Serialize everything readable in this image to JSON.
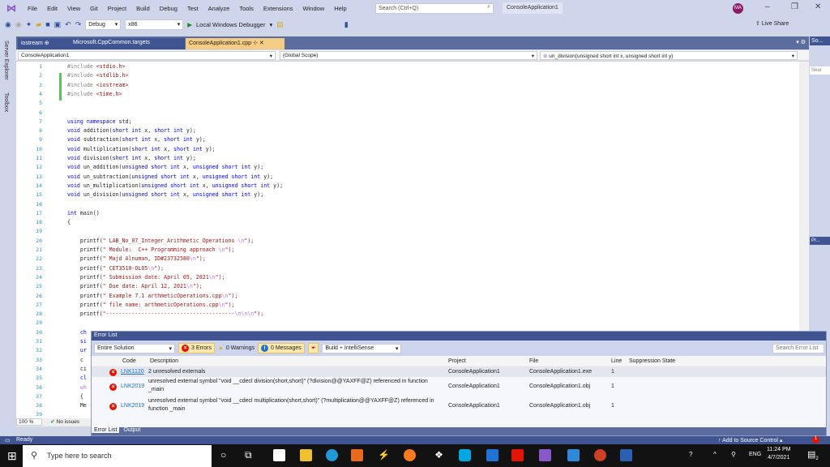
{
  "menubar": {
    "items": [
      "File",
      "Edit",
      "View",
      "Git",
      "Project",
      "Build",
      "Debug",
      "Test",
      "Analyze",
      "Tools",
      "Extensions",
      "Window",
      "Help"
    ],
    "search_placeholder": "Search (Ctrl+Q)",
    "app_title": "ConsoleApplication1",
    "avatar": "MA"
  },
  "toolbar": {
    "config": "Debug",
    "platform": "x86",
    "run_label": "Local Windows Debugger",
    "live_share": "Live Share"
  },
  "sidebar": {
    "server_explorer": "Server Explorer",
    "toolbox": "Toolbox"
  },
  "tabs": [
    {
      "label": "iostream",
      "pin": "⊕"
    },
    {
      "label": "Microsoft.CppCommon.targets"
    },
    {
      "label": "ConsoleApplication1.cpp",
      "active": true
    }
  ],
  "right_panel": {
    "label": "So...",
    "search": "Sear",
    "pr": "Pr..."
  },
  "navbar": {
    "project": "ConsoleApplication1",
    "scope": "(Global Scope)",
    "member": "un_division(unsigned short int x, unsigned short int y)"
  },
  "code_lines": [
    [
      [
        "#include ",
        "pp"
      ],
      [
        "<stdio.h>",
        "str"
      ]
    ],
    [
      [
        "#include ",
        "pp"
      ],
      [
        "<stdlib.h>",
        "str"
      ]
    ],
    [
      [
        "#include ",
        "pp"
      ],
      [
        "<iostream>",
        "str"
      ]
    ],
    [
      [
        "#include ",
        "pp"
      ],
      [
        "<time.h>",
        "str"
      ]
    ],
    [],
    [],
    [
      [
        "using namespace ",
        "kw"
      ],
      [
        "std;",
        "plain"
      ]
    ],
    [
      [
        "void ",
        "kw"
      ],
      [
        "addition(",
        "fn"
      ],
      [
        "short int ",
        "kw"
      ],
      [
        "x, ",
        "plain"
      ],
      [
        "short int ",
        "kw"
      ],
      [
        "y);",
        "plain"
      ]
    ],
    [
      [
        "void ",
        "kw"
      ],
      [
        "subtraction(",
        "fn"
      ],
      [
        "short int ",
        "kw"
      ],
      [
        "x, ",
        "plain"
      ],
      [
        "short int ",
        "kw"
      ],
      [
        "y);",
        "plain"
      ]
    ],
    [
      [
        "void ",
        "kw"
      ],
      [
        "multiplication(",
        "fn"
      ],
      [
        "short int ",
        "kw"
      ],
      [
        "x, ",
        "plain"
      ],
      [
        "short int ",
        "kw"
      ],
      [
        "y);",
        "plain"
      ]
    ],
    [
      [
        "void ",
        "kw"
      ],
      [
        "division(",
        "fn"
      ],
      [
        "short int ",
        "kw"
      ],
      [
        "x, ",
        "plain"
      ],
      [
        "short int ",
        "kw"
      ],
      [
        "y);",
        "plain"
      ]
    ],
    [
      [
        "void ",
        "kw"
      ],
      [
        "un_addition(",
        "fn"
      ],
      [
        "unsigned short int ",
        "kw"
      ],
      [
        "x, ",
        "plain"
      ],
      [
        "unsigned short int ",
        "kw"
      ],
      [
        "y);",
        "plain"
      ]
    ],
    [
      [
        "void ",
        "kw"
      ],
      [
        "un_subtraction(",
        "fn"
      ],
      [
        "unsigned short int ",
        "kw"
      ],
      [
        "x, ",
        "plain"
      ],
      [
        "unsigned short int ",
        "kw"
      ],
      [
        "y);",
        "plain"
      ]
    ],
    [
      [
        "void ",
        "kw"
      ],
      [
        "un_multiplication(",
        "fn"
      ],
      [
        "unsigned short int ",
        "kw"
      ],
      [
        "x, ",
        "plain"
      ],
      [
        "unsigned short int ",
        "kw"
      ],
      [
        "y);",
        "plain"
      ]
    ],
    [
      [
        "void ",
        "kw"
      ],
      [
        "un_division(",
        "fn"
      ],
      [
        "unsigned short int ",
        "kw"
      ],
      [
        "x, ",
        "plain"
      ],
      [
        "unsigned short int ",
        "kw"
      ],
      [
        "y);",
        "plain"
      ]
    ],
    [],
    [
      [
        "int ",
        "kw"
      ],
      [
        "main()",
        "plain"
      ]
    ],
    [
      [
        "{",
        "plain"
      ]
    ],
    [],
    [
      [
        "    printf(",
        "plain"
      ],
      [
        "\" LAB_No_07_Integer Arithmetic Operations ",
        "str"
      ],
      [
        "\\n",
        "esc"
      ],
      [
        "\");",
        "str"
      ]
    ],
    [
      [
        "    printf(",
        "plain"
      ],
      [
        "\" Module:  C++ Programming approach ",
        "str"
      ],
      [
        "\\n",
        "esc"
      ],
      [
        "\");",
        "str"
      ]
    ],
    [
      [
        "    printf(",
        "plain"
      ],
      [
        "\" Majd Alnuman, ID#23732580",
        "str"
      ],
      [
        "\\n",
        "esc"
      ],
      [
        "\");",
        "str"
      ]
    ],
    [
      [
        "    printf(",
        "plain"
      ],
      [
        "\" CET3510-OL05",
        "str"
      ],
      [
        "\\n",
        "esc"
      ],
      [
        "\");",
        "str"
      ]
    ],
    [
      [
        "    printf(",
        "plain"
      ],
      [
        "\" Submission date: April 05, 2021",
        "str"
      ],
      [
        "\\n",
        "esc"
      ],
      [
        "\");",
        "str"
      ]
    ],
    [
      [
        "    printf(",
        "plain"
      ],
      [
        "\" Due date: April 12, 2021",
        "str"
      ],
      [
        "\\n",
        "esc"
      ],
      [
        "\");",
        "str"
      ]
    ],
    [
      [
        "    printf(",
        "plain"
      ],
      [
        "\" Example 7.1 arthmeticOperations.cpp",
        "str"
      ],
      [
        "\\n",
        "esc"
      ],
      [
        "\");",
        "str"
      ]
    ],
    [
      [
        "    printf(",
        "plain"
      ],
      [
        "\" file name: arthmeticOperations.cpp",
        "str"
      ],
      [
        "\\n",
        "esc"
      ],
      [
        "\");",
        "str"
      ]
    ],
    [
      [
        "    printf(",
        "plain"
      ],
      [
        "\"----------------------------------------",
        "str"
      ],
      [
        "\\n\\n\\n",
        "esc"
      ],
      [
        "\");",
        "str"
      ]
    ],
    [],
    [
      [
        "    ch",
        "kw"
      ]
    ],
    [
      [
        "    si",
        "kw"
      ]
    ],
    [
      [
        "    ur",
        "kw"
      ]
    ],
    [
      [
        "    c",
        "plain"
      ]
    ],
    [
      [
        "    ci",
        "plain"
      ]
    ],
    [
      [
        "    cl",
        "kw"
      ]
    ],
    [
      [
        "    wh",
        "esc"
      ]
    ],
    [
      [
        "    {",
        "plain"
      ]
    ],
    [
      [
        "    Me",
        "plain"
      ]
    ],
    []
  ],
  "editor": {
    "zoom": "100 %",
    "issues": "No issues"
  },
  "error_list": {
    "title": "Error List",
    "scope": "Entire Solution",
    "errors": "3 Errors",
    "warnings": "0 Warnings",
    "messages": "0 Messages",
    "filter": "Build + IntelliSense",
    "search_placeholder": "Search Error List",
    "columns": {
      "code": "Code",
      "description": "Description",
      "project": "Project",
      "file": "File",
      "line": "Line",
      "suppression": "Suppression State"
    },
    "rows": [
      {
        "code": "LNK1120",
        "description": "2 unresolved externals",
        "project": "ConsoleApplication1",
        "file": "ConsoleApplication1.exe",
        "line": "1"
      },
      {
        "code": "LNK2019",
        "description": "unresolved external symbol \"void __cdecl division(short,short)\" (?division@@YAXFF@Z) referenced in function _main",
        "project": "ConsoleApplication1",
        "file": "ConsoleApplication1.obj",
        "line": "1"
      },
      {
        "code": "LNK2019",
        "description": "unresolved external symbol \"void __cdecl multiplication(short,short)\" (?multiplication@@YAXFF@Z) referenced in function _main",
        "project": "ConsoleApplication1",
        "file": "ConsoleApplication1.obj",
        "line": "1"
      }
    ],
    "tabs": [
      "Error List",
      "Output"
    ]
  },
  "statusbar": {
    "ready": "Ready",
    "source_control": "Add to Source Control",
    "notifications": "1"
  },
  "taskbar": {
    "search_placeholder": "Type here to search",
    "lang": "ENG",
    "time": "11:24 PM",
    "date": "4/7/2021",
    "action_center_count": "2"
  }
}
